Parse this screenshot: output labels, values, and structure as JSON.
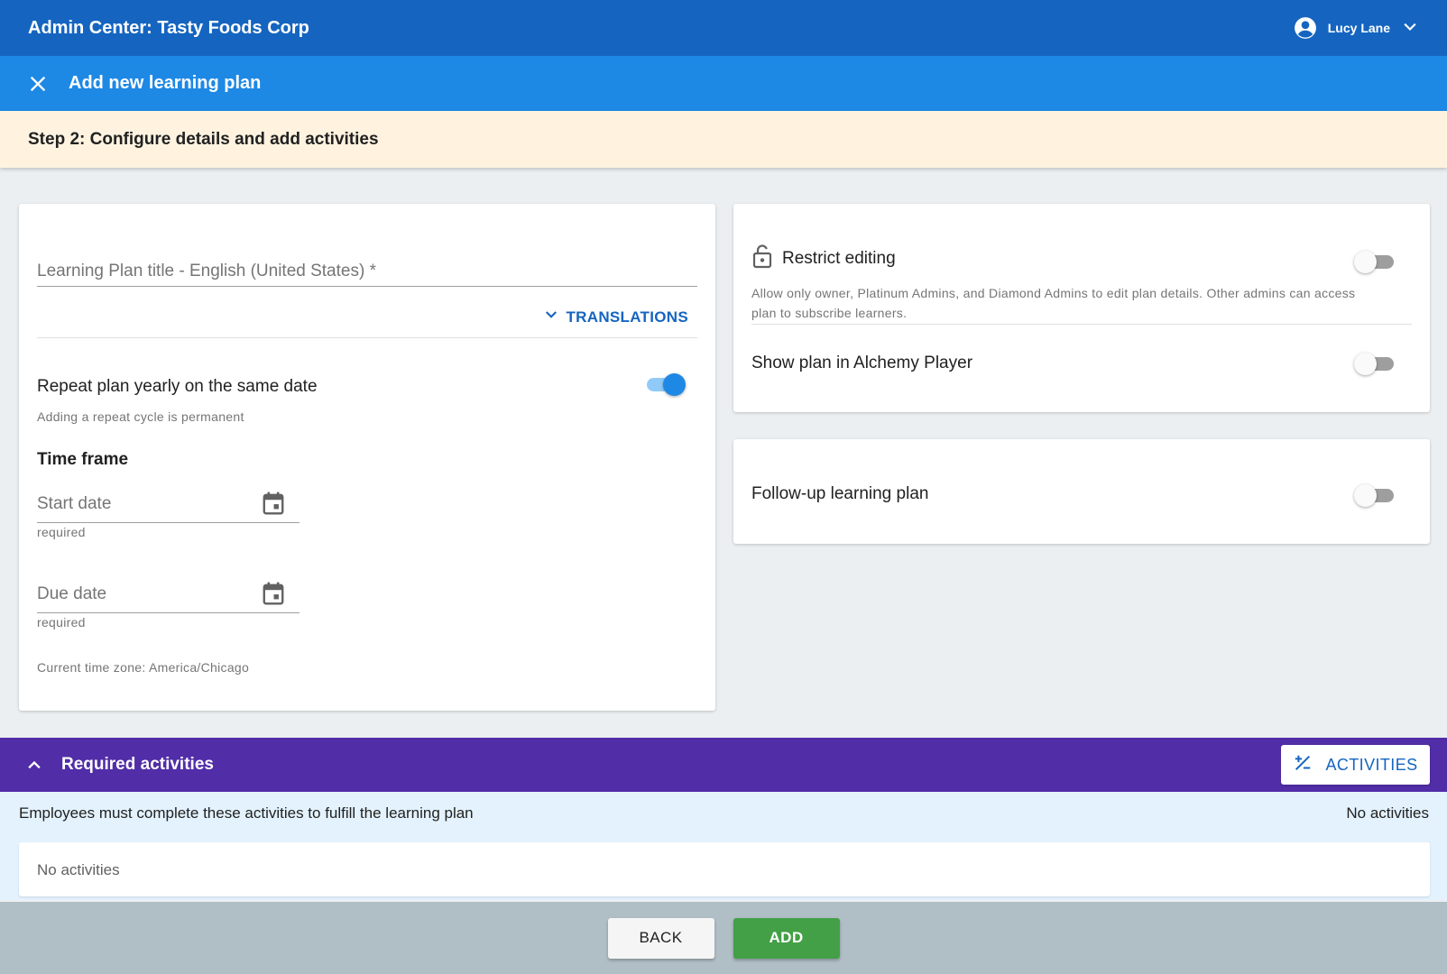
{
  "topbar": {
    "title": "Admin Center: Tasty Foods Corp",
    "user_name": "Lucy Lane",
    "avatar_icon": "account-circle-icon",
    "menu_icon": "chevron-down-icon"
  },
  "subbar": {
    "close_icon": "close-icon",
    "title": "Add new learning plan"
  },
  "step": {
    "title": "Step 2: Configure details and add activities"
  },
  "details": {
    "title_field_label": "Learning Plan title - English (United States) *",
    "title_field_value": "",
    "translations_label": "TRANSLATIONS",
    "repeat_label": "Repeat plan yearly on the same date",
    "repeat_enabled": true,
    "repeat_help": "Adding a repeat cycle is permanent",
    "timeframe_heading": "Time frame",
    "start_date_label": "Start date",
    "start_date_value": "",
    "start_date_help": "required",
    "due_date_label": "Due date",
    "due_date_value": "",
    "due_date_help": "required",
    "timezone": "Current time zone: America/Chicago"
  },
  "settings": {
    "restrict_label": "Restrict editing",
    "restrict_enabled": false,
    "restrict_help": "Allow only owner, Platinum Admins, and Diamond Admins to edit plan details. Other admins can access plan to subscribe learners.",
    "show_plan_label": "Show plan in Alchemy Player",
    "show_plan_enabled": false,
    "followup_label": "Follow-up learning plan",
    "followup_enabled": false
  },
  "required_activities": {
    "title": "Required activities",
    "activities_button": "ACTIVITIES",
    "description": "Employees must complete these activities to fulfill the learning plan",
    "count_text": "No activities",
    "empty_text": "No activities"
  },
  "footer": {
    "back_label": "BACK",
    "add_label": "ADD"
  },
  "colors": {
    "primary_dark": "#1565c0",
    "primary": "#1e88e5",
    "step_bg": "#fff3e0",
    "purple": "#512da8",
    "success": "#43a047"
  }
}
